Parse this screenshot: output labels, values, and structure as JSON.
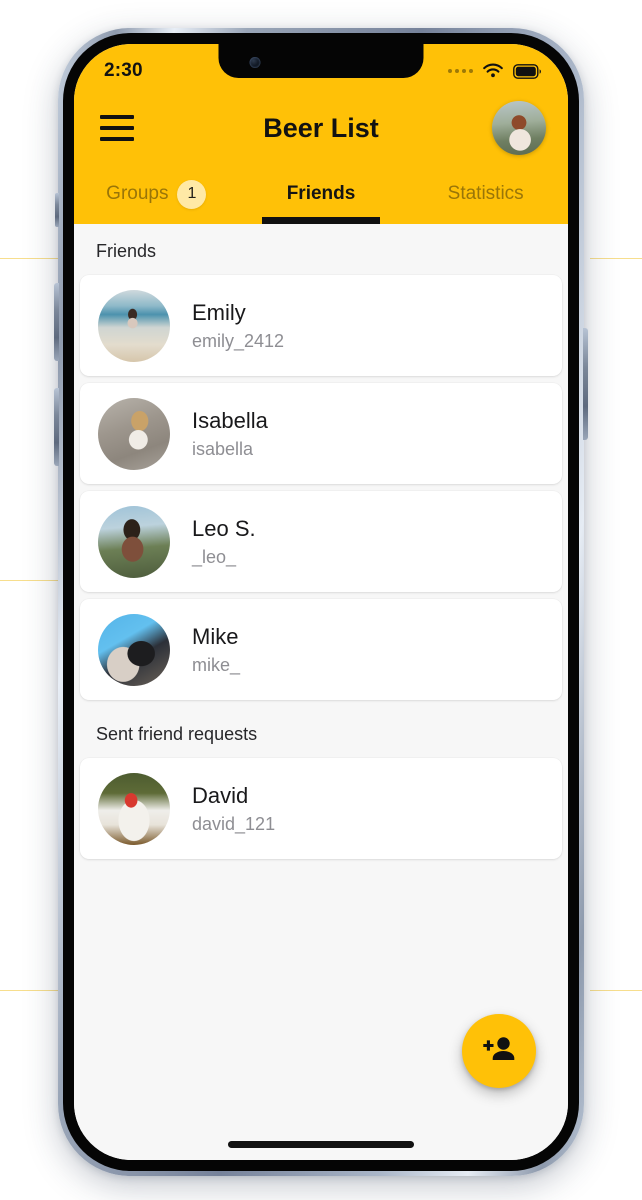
{
  "status_bar": {
    "time": "2:30",
    "cellular_icon": "cellular-dots-icon",
    "wifi_icon": "wifi-icon",
    "battery_icon": "battery-full-icon"
  },
  "header": {
    "menu_icon": "hamburger-menu-icon",
    "title": "Beer List",
    "avatar_icon": "user-avatar"
  },
  "tabs": [
    {
      "label": "Groups",
      "badge": "1",
      "active": false
    },
    {
      "label": "Friends",
      "badge": null,
      "active": true
    },
    {
      "label": "Statistics",
      "badge": null,
      "active": false
    }
  ],
  "sections": [
    {
      "title": "Friends",
      "items": [
        {
          "name": "Emily",
          "handle": "emily_2412",
          "avatar": "emily"
        },
        {
          "name": "Isabella",
          "handle": "isabella",
          "avatar": "isabella"
        },
        {
          "name": "Leo S.",
          "handle": "_leo_",
          "avatar": "leo"
        },
        {
          "name": "Mike",
          "handle": "mike_",
          "avatar": "mike"
        }
      ]
    },
    {
      "title": "Sent friend requests",
      "items": [
        {
          "name": "David",
          "handle": "david_121",
          "avatar": "david"
        }
      ]
    }
  ],
  "fab": {
    "icon": "person-add-icon",
    "label": "Add friend"
  },
  "colors": {
    "accent": "#FFC107",
    "badge_bg": "#FFE9A6",
    "card_bg": "#FFFFFF",
    "page_bg": "#F7F7F7",
    "text_primary": "#19191B",
    "text_secondary": "#8E8E93",
    "tab_inactive": "#6B5A1E"
  }
}
